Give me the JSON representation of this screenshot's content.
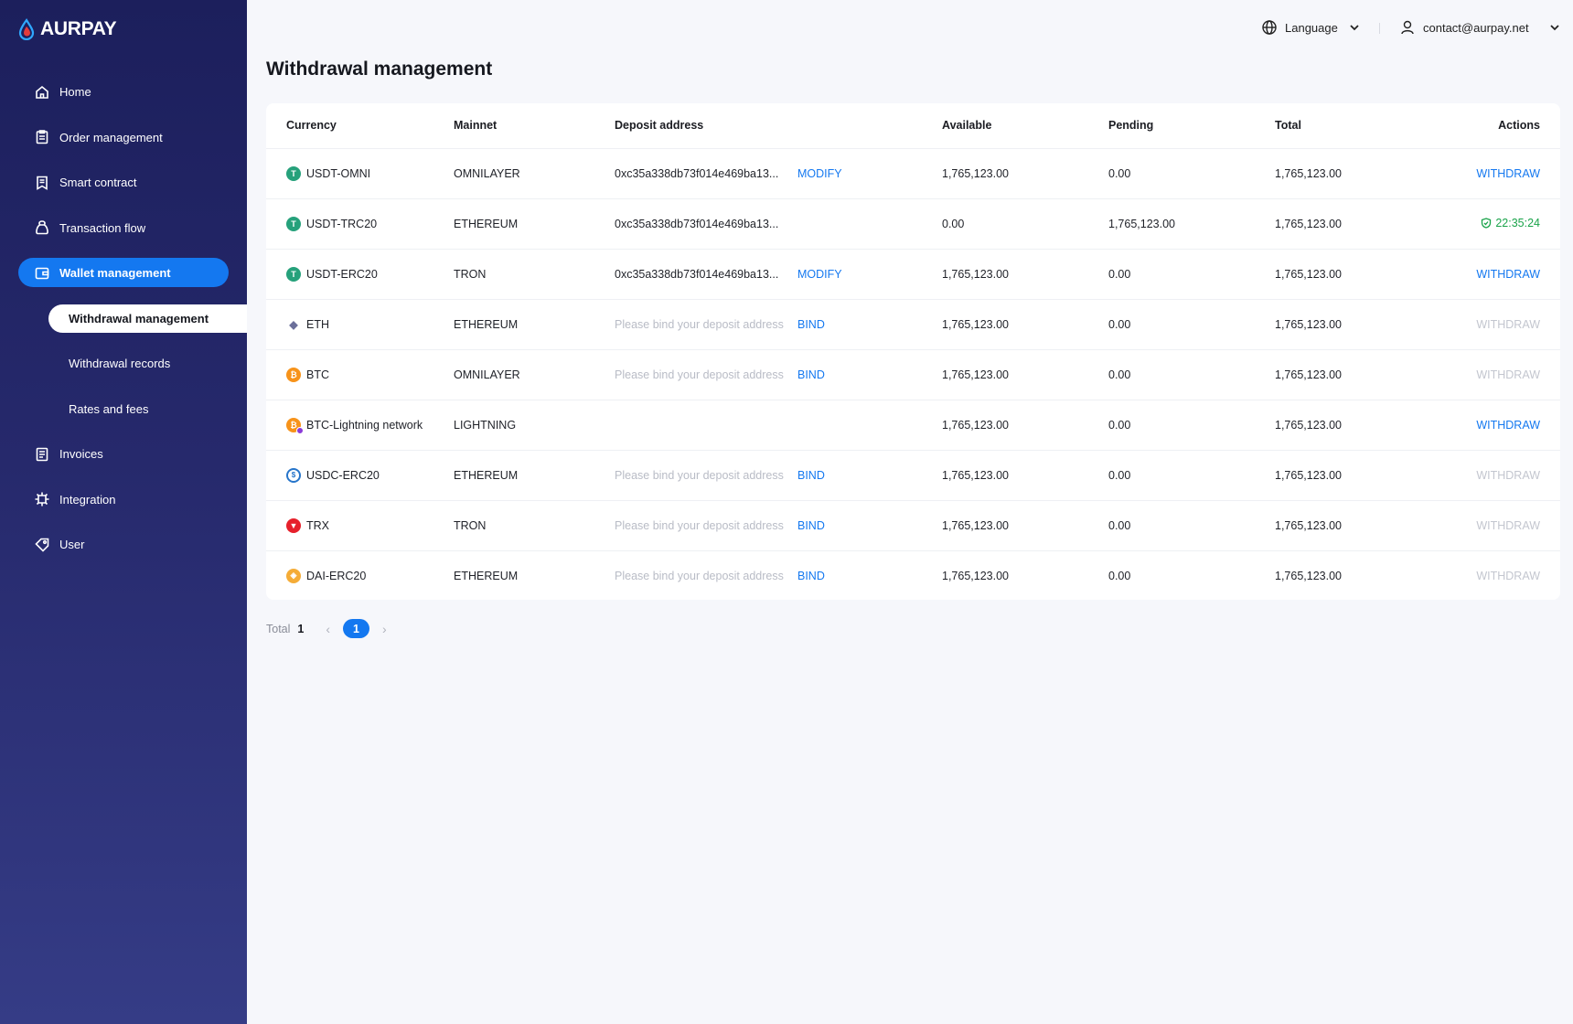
{
  "brand": {
    "name": "AURPAY"
  },
  "sidebar": {
    "items": [
      {
        "label": "Home",
        "icon": "home-icon"
      },
      {
        "label": "Order management",
        "icon": "clipboard-icon"
      },
      {
        "label": "Smart contract",
        "icon": "document-icon"
      },
      {
        "label": "Transaction flow",
        "icon": "bag-icon"
      },
      {
        "label": "Wallet management",
        "icon": "wallet-icon",
        "active": true
      },
      {
        "label": "Invoices",
        "icon": "invoice-icon"
      },
      {
        "label": "Integration",
        "icon": "chip-icon"
      },
      {
        "label": "User",
        "icon": "tag-icon"
      }
    ],
    "sub_items": [
      {
        "label": "Withdrawal management",
        "active": true
      },
      {
        "label": "Withdrawal records"
      },
      {
        "label": "Rates and fees"
      }
    ]
  },
  "topbar": {
    "language_label": "Language",
    "account_email": "contact@aurpay.net"
  },
  "page": {
    "title": "Withdrawal management"
  },
  "table": {
    "columns": [
      "Currency",
      "Mainnet",
      "Deposit address",
      "Available",
      "Pending",
      "Total",
      "Actions"
    ],
    "rows": [
      {
        "currency": "USDT-OMNI",
        "coin_icon": "tether-icon",
        "mainnet": "OMNILAYER",
        "address": "0xc35a338db73f014e469ba13...",
        "address_action": "MODIFY",
        "available": "1,765,123.00",
        "pending": "0.00",
        "total": "1,765,123.00",
        "action": "WITHDRAW",
        "action_enabled": true
      },
      {
        "currency": "USDT-TRC20",
        "coin_icon": "tether-icon",
        "mainnet": "ETHEREUM",
        "address": "0xc35a338db73f014e469ba13...",
        "address_action": "",
        "available": "0.00",
        "pending": "1,765,123.00",
        "total": "1,765,123.00",
        "action": "22:35:24",
        "action_timer": true
      },
      {
        "currency": "USDT-ERC20",
        "coin_icon": "tether-icon",
        "mainnet": "TRON",
        "address": "0xc35a338db73f014e469ba13...",
        "address_action": "MODIFY",
        "available": "1,765,123.00",
        "pending": "0.00",
        "total": "1,765,123.00",
        "action": "WITHDRAW",
        "action_enabled": true
      },
      {
        "currency": "ETH",
        "coin_icon": "ethereum-icon",
        "mainnet": "ETHEREUM",
        "address": "Please bind your deposit address",
        "address_placeholder": true,
        "address_action": "BIND",
        "available": "1,765,123.00",
        "pending": "0.00",
        "total": "1,765,123.00",
        "action": "WITHDRAW",
        "action_enabled": false
      },
      {
        "currency": "BTC",
        "coin_icon": "bitcoin-icon",
        "mainnet": "OMNILAYER",
        "address": "Please bind your deposit address",
        "address_placeholder": true,
        "address_action": "BIND",
        "available": "1,765,123.00",
        "pending": "0.00",
        "total": "1,765,123.00",
        "action": "WITHDRAW",
        "action_enabled": false
      },
      {
        "currency": "BTC-Lightning network",
        "coin_icon": "bitcoin-lightning-icon",
        "mainnet": "LIGHTNING",
        "address": "",
        "address_action": "",
        "available": "1,765,123.00",
        "pending": "0.00",
        "total": "1,765,123.00",
        "action": "WITHDRAW",
        "action_enabled": true
      },
      {
        "currency": "USDC-ERC20",
        "coin_icon": "usdc-icon",
        "mainnet": "ETHEREUM",
        "address": "Please bind your deposit address",
        "address_placeholder": true,
        "address_action": "BIND",
        "available": "1,765,123.00",
        "pending": "0.00",
        "total": "1,765,123.00",
        "action": "WITHDRAW",
        "action_enabled": false
      },
      {
        "currency": "TRX",
        "coin_icon": "tron-icon",
        "mainnet": "TRON",
        "address": "Please bind your deposit address",
        "address_placeholder": true,
        "address_action": "BIND",
        "available": "1,765,123.00",
        "pending": "0.00",
        "total": "1,765,123.00",
        "action": "WITHDRAW",
        "action_enabled": false
      },
      {
        "currency": "DAI-ERC20",
        "coin_icon": "dai-icon",
        "mainnet": "ETHEREUM",
        "address": "Please bind your deposit address",
        "address_placeholder": true,
        "address_action": "BIND",
        "available": "1,765,123.00",
        "pending": "0.00",
        "total": "1,765,123.00",
        "action": "WITHDRAW",
        "action_enabled": false
      }
    ]
  },
  "pagination": {
    "total_label": "Total",
    "total": "1",
    "current_page": "1"
  },
  "colors": {
    "accent": "#1478f0",
    "success": "#1aa34a",
    "sidebar_top": "#1c1f5c",
    "sidebar_bottom": "#353c86"
  }
}
